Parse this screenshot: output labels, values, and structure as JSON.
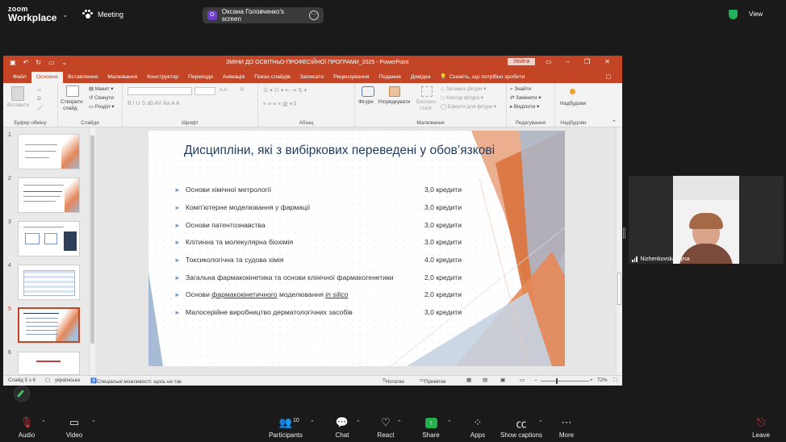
{
  "zoom": {
    "brand_line1": "zoom",
    "brand_line2": "Workplace",
    "meeting_label": "Meeting",
    "screen_share_label": "Оксана Головченко's screen",
    "share_initial": "O",
    "view_label": "View",
    "toolbar": {
      "audio": "Audio",
      "video": "Video",
      "participants": "Participants",
      "participants_count": "10",
      "chat": "Chat",
      "react": "React",
      "share": "Share",
      "apps": "Apps",
      "captions": "Show captions",
      "more": "More",
      "leave": "Leave"
    },
    "participant_video": {
      "name": "Nizhenkovska Iryna"
    }
  },
  "powerpoint": {
    "doc_title": "ЗМІНИ ДО ОСВІТНЬО-ПРОФЕСІЙНОЇ ПРОГРАМИ_2025  -  PowerPoint",
    "signin": "Увійти",
    "tabs": [
      "Файл",
      "Основне",
      "Вставлення",
      "Малювання",
      "Конструктор",
      "Переходи",
      "Анімація",
      "Показ слайдів",
      "Записати",
      "Рецензування",
      "Подання",
      "Довідка"
    ],
    "active_tab": "Основне",
    "tell_me": "Скажіть, що потрібно зробити",
    "ribbon": {
      "paste": "Вставити",
      "clipboard_group": "Буфер обміну",
      "new_slide_1": "Створити",
      "new_slide_2": "слайд",
      "layout": "Макет",
      "reset": "Скинути",
      "section": "Розділ",
      "slides_group": "Слайди",
      "font_group": "Шрифт",
      "paragraph_group": "Абзац",
      "shapes": "Фігури",
      "arrange": "Упорядкувати",
      "quick_styles_1": "Експрес-",
      "quick_styles_2": "стилі",
      "shape_fill": "Заливка фігури",
      "shape_outline": "Контур фігури",
      "shape_effects": "Ефекти для фігури",
      "drawing_group": "Малювання",
      "find": "Знайти",
      "replace": "Замінити",
      "select": "Виділити",
      "editing_group": "Редагування",
      "designer": "Надбудови",
      "addins_group": "Надбудови"
    },
    "thumb_numbers": [
      "1",
      "2",
      "3",
      "4",
      "5",
      "6"
    ],
    "selected_slide": 5,
    "slide": {
      "title": "Дисципліни, які з вибіркових переведені у обов’язкові",
      "items": [
        {
          "name": "Основи хімічної метрології",
          "credits": "3,0 кредити"
        },
        {
          "name": "Комп’ютерне моделювання у фармації",
          "credits": "3,0 кредити"
        },
        {
          "name": "Основи патентознавства",
          "credits": "3,0 кредити"
        },
        {
          "name": "Клітинна та молекулярна біохімія",
          "credits": "3,0 кредити"
        },
        {
          "name": "Токсикологічна та судова хімія",
          "credits": "4,0 кредити"
        },
        {
          "name": "Загальна фармакокінетика та основи клінічної фармакогенетики",
          "credits": "2,0 кредити"
        },
        {
          "name_pre": "Основи ",
          "name_u": "фармакокінетичного",
          "name_mid": " моделювання ",
          "name_i": "in silico",
          "credits": "2,0 кредити"
        },
        {
          "name": "Малосерійне виробництво дерматологічних засобів",
          "credits": "3,0 кредити"
        }
      ]
    },
    "status": {
      "slide_of": "Слайд 5 з 6",
      "language": "українська",
      "accessibility": "Спеціальні можливості: щось не так",
      "notes": "Нотатки",
      "comments": "Примітки",
      "zoom": "72%"
    }
  }
}
